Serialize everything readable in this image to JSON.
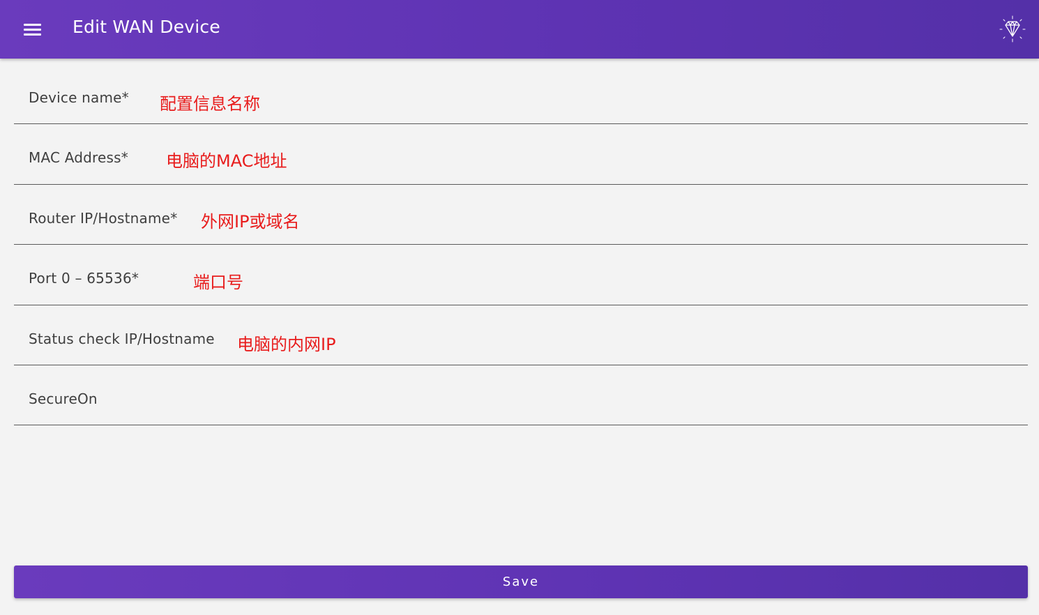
{
  "app_bar": {
    "title": "Edit WAN Device",
    "menu_icon": "hamburger-menu-icon",
    "action_icon": "diamond-gem-icon",
    "color": "#5e33b3"
  },
  "form": {
    "fields": [
      {
        "label": "Device name*",
        "value": "配置信息名称"
      },
      {
        "label": "MAC Address*",
        "value": "电脑的MAC地址"
      },
      {
        "label": "Router IP/Hostname*",
        "value": "外网IP或域名"
      },
      {
        "label": "Port 0 – 65536*",
        "value": "端口号"
      },
      {
        "label": "Status check IP/Hostname",
        "value": "电脑的内网IP"
      },
      {
        "label": "SecureOn",
        "value": ""
      }
    ],
    "value_color": "#e81c1c"
  },
  "save_button": {
    "label": "Save"
  }
}
